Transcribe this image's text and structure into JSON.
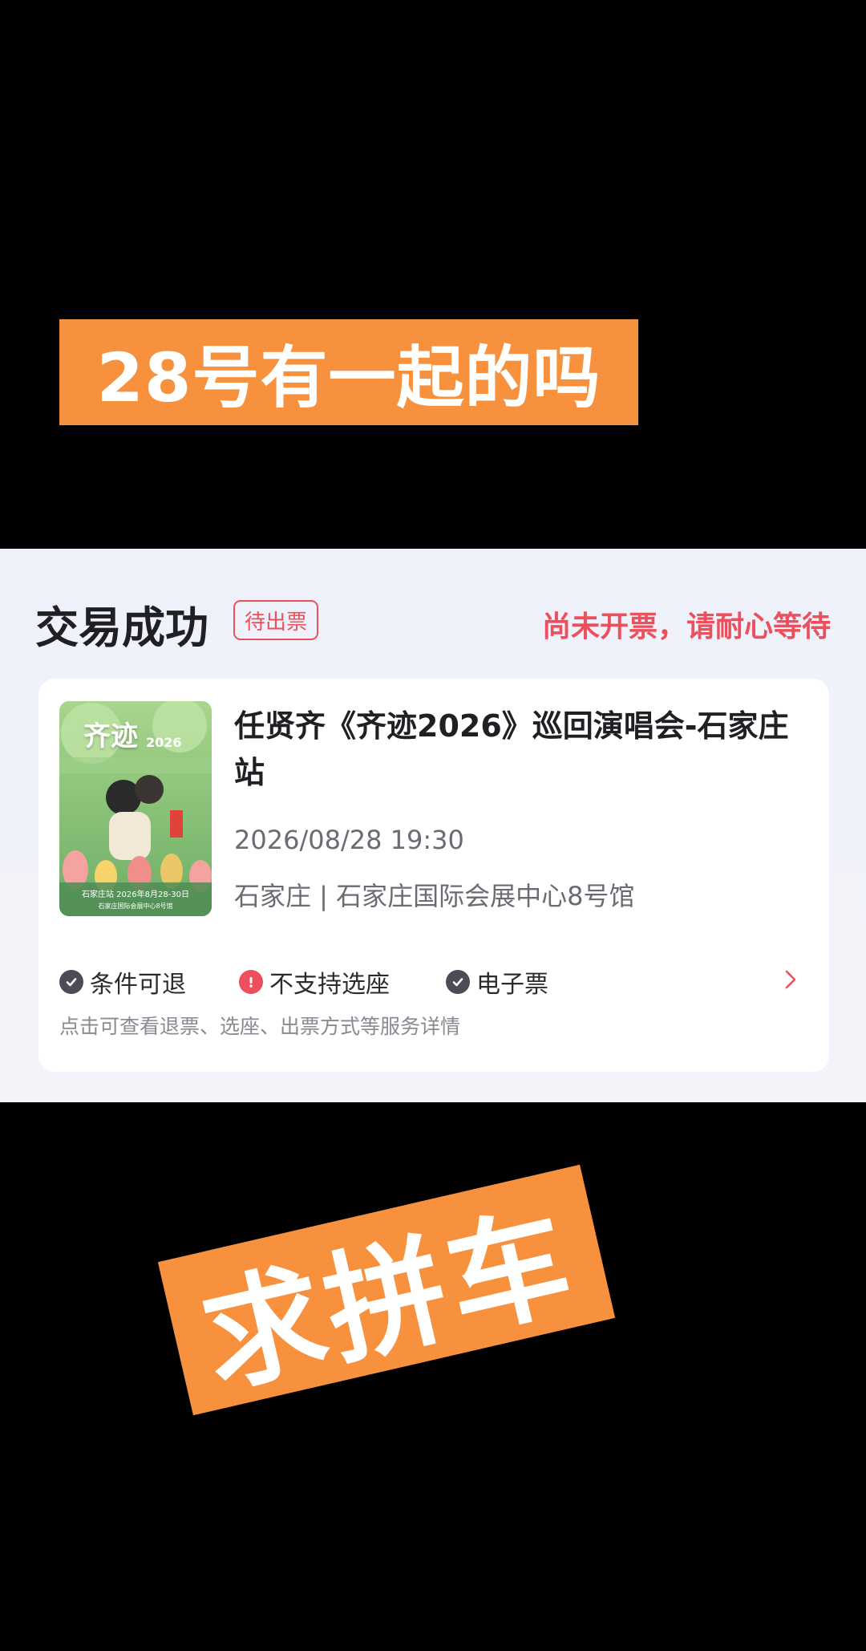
{
  "overlay": {
    "top_banner": "28号有一起的吗",
    "bottom_banner": "求拼车",
    "banner_color": "#f7913d"
  },
  "order": {
    "status": "交易成功",
    "badge": "待出票",
    "hint": "尚未开票，请耐心等待",
    "accent_color": "#ee4f5c"
  },
  "event": {
    "poster": {
      "title": "齐迹",
      "title_year": "2026",
      "caption_line1": "石家庄站  2026年8月28-30日",
      "caption_line2": "石家庄国际会展中心8号馆"
    },
    "title": "任贤齐《齐迹2026》巡回演唱会-石家庄站",
    "datetime": "2026/08/28 19:30",
    "venue": "石家庄 | 石家庄国际会展中心8号馆"
  },
  "services": {
    "items": [
      {
        "label": "条件可退",
        "icon": "check-circle-icon"
      },
      {
        "label": "不支持选座",
        "icon": "alert-circle-icon"
      },
      {
        "label": "电子票",
        "icon": "check-circle-icon"
      }
    ],
    "note": "点击可查看退票、选座、出票方式等服务详情"
  }
}
